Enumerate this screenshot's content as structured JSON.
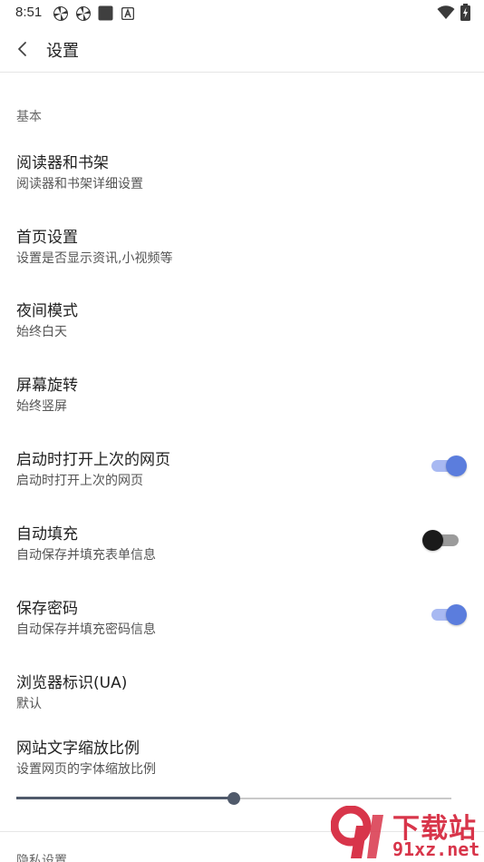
{
  "status_bar": {
    "time": "8:51",
    "icons_left": [
      "pinwheel-icon",
      "pinwheel-icon",
      "square-app-icon",
      "a-badge-icon"
    ],
    "icons_right": [
      "wifi-icon",
      "battery-charging-icon"
    ]
  },
  "toolbar": {
    "title": "设置",
    "back_icon": "chevron-left-icon"
  },
  "sections": {
    "basic": "基本",
    "next": "隐私设置"
  },
  "items": [
    {
      "title": "阅读器和书架",
      "subtitle": "阅读器和书架详细设置"
    },
    {
      "title": "首页设置",
      "subtitle": "设置是否显示资讯,小视频等"
    },
    {
      "title": "夜间模式",
      "subtitle": "始终白天"
    },
    {
      "title": "屏幕旋转",
      "subtitle": "始终竖屏"
    },
    {
      "title": "启动时打开上次的网页",
      "subtitle": "启动时打开上次的网页",
      "toggle": true
    },
    {
      "title": "自动填充",
      "subtitle": "自动保存并填充表单信息",
      "toggle": false
    },
    {
      "title": "保存密码",
      "subtitle": "自动保存并填充密码信息",
      "toggle": true
    },
    {
      "title": "浏览器标识(UA)",
      "subtitle": "默认"
    },
    {
      "title": "网站文字缩放比例",
      "subtitle": "设置网页的字体缩放比例"
    }
  ],
  "font_scale_slider": {
    "fraction": 0.5
  },
  "colors": {
    "toggle_on_thumb": "#5b7ddd",
    "toggle_on_track": "#a8b9f2",
    "toggle_off_thumb": "#1a1a1a",
    "slider": "#505a6b",
    "watermark": "#d8354a"
  },
  "watermark": {
    "line1": "下载站",
    "line2": "91xz.net"
  }
}
